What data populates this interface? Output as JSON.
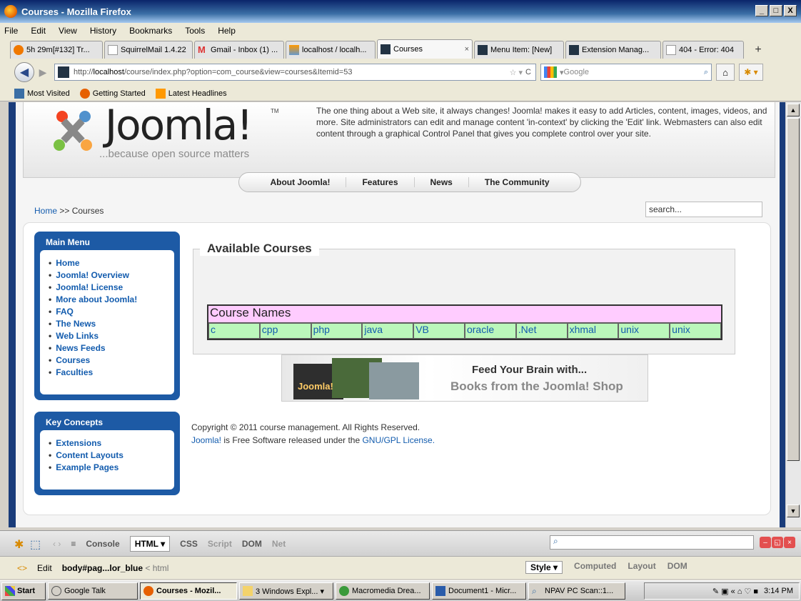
{
  "window": {
    "title": "Courses - Mozilla Firefox",
    "min": "_",
    "max": "□",
    "close": "X"
  },
  "menus": [
    "File",
    "Edit",
    "View",
    "History",
    "Bookmarks",
    "Tools",
    "Help"
  ],
  "tabs": [
    {
      "label": "5h 29m[#132] Tr..."
    },
    {
      "label": "SquirrelMail 1.4.22"
    },
    {
      "label": "Gmail - Inbox (1) ..."
    },
    {
      "label": "localhost / localh..."
    },
    {
      "label": "Courses",
      "close": "×"
    },
    {
      "label": "Menu Item: [New]"
    },
    {
      "label": "Extension Manag..."
    },
    {
      "label": "404 - Error: 404"
    }
  ],
  "tab_new": "+",
  "url": {
    "prefix": "http://",
    "host": "localhost",
    "path": "/course/index.php?option=com_course&view=courses&Itemid=53"
  },
  "search_engine": "Google",
  "bookmarks": [
    "Most Visited",
    "Getting Started",
    "Latest Headlines"
  ],
  "site": {
    "logo_word": "Joomla!",
    "logo_tm": "TM",
    "tagline": "...because open source matters",
    "intro": "The one thing about a Web site, it always changes! Joomla! makes it easy to add Articles, content, images, videos, and more. Site administrators can edit and manage content 'in-context' by clicking the 'Edit' link. Webmasters can also edit content through a graphical Control Panel that gives you complete control over your site.",
    "topnav": [
      "About Joomla!",
      "Features",
      "News",
      "The Community"
    ],
    "breadcrumb": {
      "home": "Home",
      "sep": ">>",
      "current": "Courses"
    },
    "search_value": "search...",
    "main_menu": {
      "title": "Main Menu",
      "items": [
        "Home",
        "Joomla! Overview",
        "Joomla! License",
        "More about Joomla!",
        "FAQ",
        "The News",
        "Web Links",
        "News Feeds",
        "Courses",
        "Faculties"
      ]
    },
    "key_concepts": {
      "title": "Key Concepts",
      "items": [
        "Extensions",
        "Content Layouts",
        "Example Pages"
      ]
    },
    "courses": {
      "title": "Available Courses",
      "table_header": "Course Names",
      "names": [
        "c",
        "cpp",
        "php",
        "java",
        "VB",
        "oracle",
        ".Net",
        "xhmal",
        "unix",
        "unix"
      ]
    },
    "banner": {
      "book_label": "Joomla!",
      "line1": "Feed Your Brain with...",
      "line2": "Books from the Joomla! Shop"
    },
    "footer": {
      "copyright": "Copyright © 2011 course management. All Rights Reserved.",
      "joomla_link": "Joomla!",
      "middle": " is Free Software released under the ",
      "license_link": "GNU/GPL License."
    }
  },
  "firebug": {
    "tabs": [
      "Console",
      "HTML ▾",
      "CSS",
      "Script",
      "DOM",
      "Net"
    ],
    "edit": "Edit",
    "path_bold": "body#pag...lor_blue",
    "path_rest": "< html",
    "side_tabs": [
      "Style ▾",
      "Computed",
      "Layout",
      "DOM"
    ]
  },
  "taskbar": {
    "start": "Start",
    "tasks": [
      "Google Talk",
      "Courses - Mozil...",
      "3 Windows Expl... ▾",
      "Macromedia Drea...",
      "Document1 - Micr...",
      "NPAV PC Scan::1..."
    ],
    "clock": "3:14 PM"
  }
}
